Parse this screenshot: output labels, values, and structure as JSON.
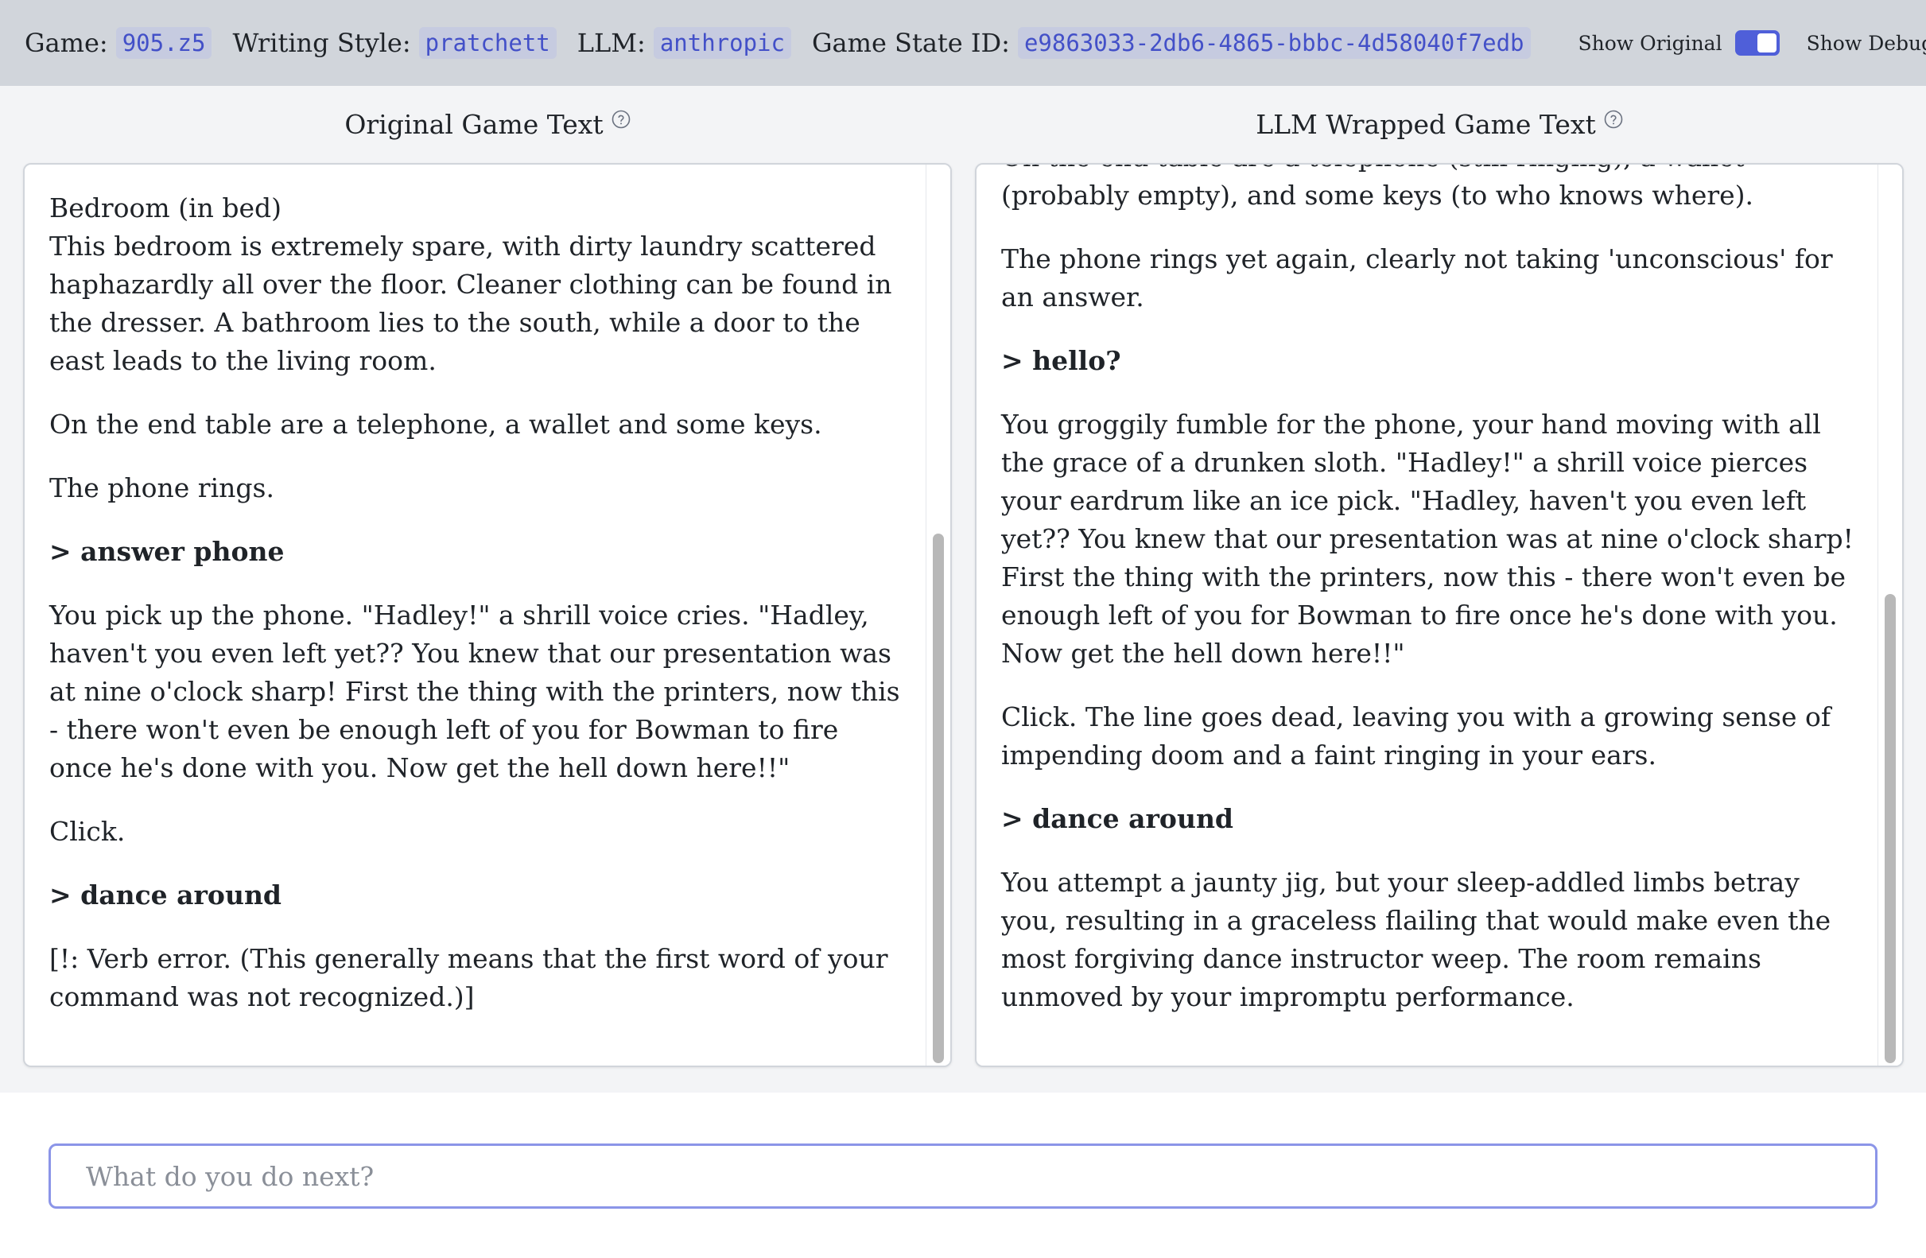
{
  "header": {
    "game_label": "Game:",
    "game_value": "905.z5",
    "style_label": "Writing Style:",
    "style_value": "pratchett",
    "llm_label": "LLM:",
    "llm_value": "anthropic",
    "state_label": "Game State ID:",
    "state_value": "e9863033-2db6-4865-bbbc-4d58040f7edb",
    "show_original_label": "Show Original",
    "show_original_on": true,
    "show_debug_label": "Show Debug",
    "show_debug_on": false
  },
  "original_panel": {
    "title": "Original Game Text",
    "paragraphs": [
      {
        "type": "text",
        "text": "Bedroom (in bed)\nThis bedroom is extremely spare, with dirty laundry scattered haphazardly all over the floor. Cleaner clothing can be found in the dresser. A bathroom lies to the south, while a door to the east leads to the living room."
      },
      {
        "type": "text",
        "text": "On the end table are a telephone, a wallet and some keys."
      },
      {
        "type": "text",
        "text": "The phone rings."
      },
      {
        "type": "cmd",
        "text": "> answer phone"
      },
      {
        "type": "text",
        "text": "You pick up the phone. \"Hadley!\" a shrill voice cries. \"Hadley, haven't you even left yet?? You knew that our presentation was at nine o'clock sharp! First the thing with the printers, now this - there won't even be enough left of you for Bowman to fire once he's done with you. Now get the hell down here!!\""
      },
      {
        "type": "text",
        "text": "Click."
      },
      {
        "type": "cmd",
        "text": "> dance around"
      },
      {
        "type": "text",
        "text": "[!: Verb error. (This generally means that the first word of your command was not recognized.)]"
      }
    ]
  },
  "llm_panel": {
    "title": "LLM Wrapped Game Text",
    "paragraphs": [
      {
        "type": "text",
        "text": "On the end table are a telephone (still ringing), a wallet (probably empty), and some keys (to who knows where)."
      },
      {
        "type": "text",
        "text": "The phone rings yet again, clearly not taking 'unconscious' for an answer."
      },
      {
        "type": "cmd",
        "text": "> hello?"
      },
      {
        "type": "text",
        "text": "You groggily fumble for the phone, your hand moving with all the grace of a drunken sloth. \"Hadley!\" a shrill voice pierces your eardrum like an ice pick. \"Hadley, haven't you even left yet?? You knew that our presentation was at nine o'clock sharp! First the thing with the printers, now this - there won't even be enough left of you for Bowman to fire once he's done with you. Now get the hell down here!!\""
      },
      {
        "type": "text",
        "text": "Click. The line goes dead, leaving you with a growing sense of impending doom and a faint ringing in your ears."
      },
      {
        "type": "cmd",
        "text": "> dance around"
      },
      {
        "type": "text",
        "text": "You attempt a jaunty jig, but your sleep-addled limbs betray you, resulting in a graceless flailing that would make even the most forgiving dance instructor weep. The room remains unmoved by your impromptu performance."
      }
    ]
  },
  "input": {
    "placeholder": "What do you do next?",
    "value": ""
  },
  "colors": {
    "accent": "#4f5fd9",
    "header_bg": "#d1d5db",
    "main_bg": "#f3f4f6",
    "code_text": "#4350c8"
  },
  "icons": {
    "help": "question-circle-icon"
  }
}
